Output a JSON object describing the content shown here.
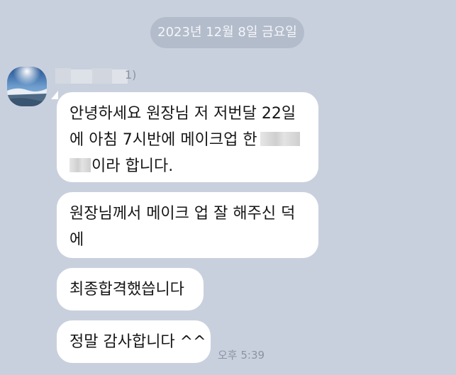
{
  "chat": {
    "date_divider": "2023년 12월 8일 금요일",
    "sender": {
      "name_suffix": "1)",
      "avatar_icon": "profile-photo-sky-icon"
    },
    "messages": [
      {
        "lines": [
          "안녕하세요 원장님 저 저번달 22일",
          "에 아침 7시반에 메이크업 한",
          "이라 합니다."
        ]
      },
      {
        "lines": [
          "원장님께서 메이크 업 잘 해주신 덕",
          "에"
        ]
      },
      {
        "lines": [
          "최종합격했씁니다"
        ]
      },
      {
        "lines": [
          "정말 감사합니다 ^^"
        ]
      }
    ],
    "timestamp": "오후 5:39"
  },
  "colors": {
    "background": "#c9d0dd",
    "date_pill": "#b3bccb",
    "bubble": "#ffffff",
    "timestamp_text": "#8b93a3"
  }
}
